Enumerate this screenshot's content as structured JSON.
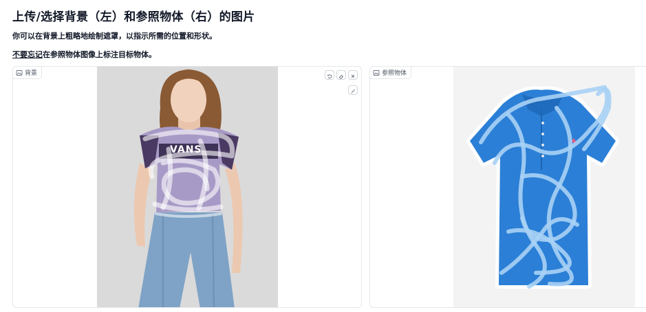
{
  "header": {
    "title": "上传/选择背景（左）和参照物体（右）的图片",
    "subtitle": "你可以在背景上粗略地绘制遮罩，以指示所需的位置和形状。",
    "reminder_underlined": "不要忘记",
    "reminder_rest": "在参照物体图像上标注目标物体。"
  },
  "background_panel": {
    "label": "背景",
    "label_icon": "image-icon",
    "tools": [
      "undo-icon",
      "eraser-icon",
      "close-icon"
    ],
    "brush_icon": "brush-icon",
    "shirt_logo_text": "VANS"
  },
  "reference_panel": {
    "label": "参照物体",
    "label_icon": "image-icon"
  },
  "colors": {
    "mask_stroke": "#ffffff",
    "left_shirt": "#a89ac6",
    "left_shirt_dark": "#4a3a63",
    "jeans": "#7fa3c6",
    "polo": "#2b7fd6",
    "polo_mask": "#9ec8f0"
  }
}
